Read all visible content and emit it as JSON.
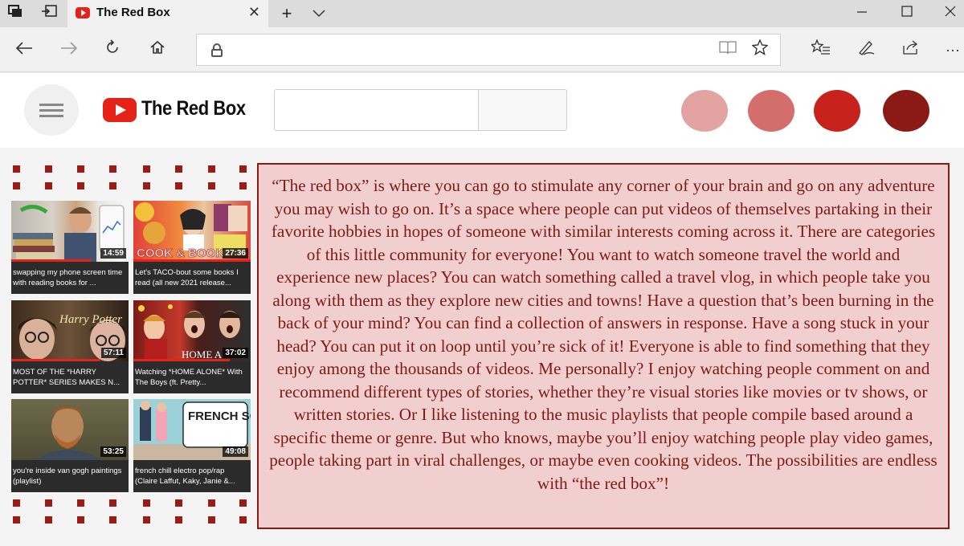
{
  "browser": {
    "tab_title": "The Red Box",
    "url": ""
  },
  "site": {
    "logo_text": "The Red Box",
    "search_placeholder": "",
    "swatches": [
      "#e3a3a3",
      "#d36e6d",
      "#c8221c",
      "#8b1a16"
    ]
  },
  "videos": [
    {
      "title": "swapping my phone screen time with reading books for ...",
      "duration": "14:59",
      "thumb_text": ""
    },
    {
      "title": "Let's TACO-bout some books I read (all new 2021 release...",
      "duration": "27:36",
      "thumb_text": "COOK & BOOK"
    },
    {
      "title": "MOST OF THE *HARRY POTTER* SERIES MAKES N...",
      "duration": "57:11",
      "thumb_text": "Harry Potter"
    },
    {
      "title": "Watching *HOME ALONE* With The Boys (ft. Pretty...",
      "duration": "37:02",
      "thumb_text": "HOME A"
    },
    {
      "title": "you're inside van gogh paintings (playlist)",
      "duration": "53:25",
      "thumb_text": ""
    },
    {
      "title": "french chill electro pop/rap (Claire Laffut, Kaky, Janie &...",
      "duration": "49:08",
      "thumb_text": "FRENCH SONGS"
    }
  ],
  "description": "“The red box” is where you can go to stimulate any corner of your brain and go on any adventure you may wish to go on. It’s a space where people can put videos of themselves partaking in their favorite hobbies in hopes of someone with similar interests coming across it. There are categories of this little community for everyone! You want to watch someone travel the world and experience new places? You can watch something called a travel vlog, in which people take you along with them as they explore new cities and towns! Have a question that’s been burning in the back of your mind? You can find a collection of answers in response. Have a song stuck in your head? You can put it on loop until you’re sick of it! Everyone is able to find something that they enjoy among the thousands of videos. Me personally? I enjoy watching people comment on and recommend different types of stories, whether they’re visual stories like movies or tv shows, or written stories. Or I like listening to the music playlists that people compile based around a specific theme or genre. But who knows, maybe you’ll enjoy watching people play video games, people taking part in viral challenges, or maybe even cooking videos. The possibilities are endless with “the red box”!"
}
